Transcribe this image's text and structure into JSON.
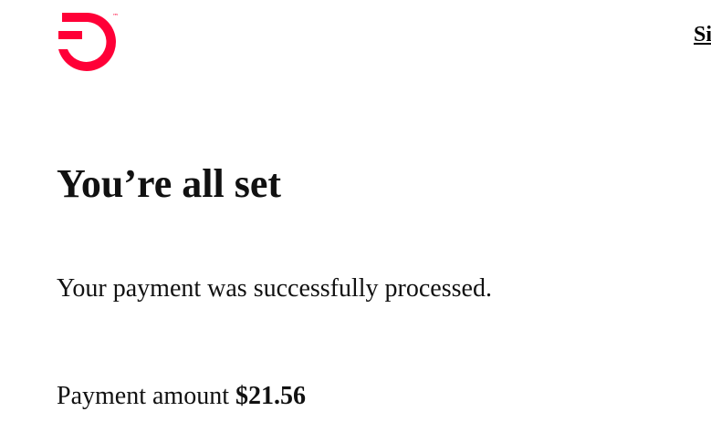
{
  "brand": {
    "logo_icon": "frontier-logo-icon",
    "trademark": "™",
    "accent_color": "#ff0037"
  },
  "header": {
    "sign_link_label": "Si"
  },
  "main": {
    "title": "You’re all set",
    "message": "Your payment was successfully processed.",
    "payment_label": "Payment amount",
    "payment_amount": "$21.56"
  }
}
